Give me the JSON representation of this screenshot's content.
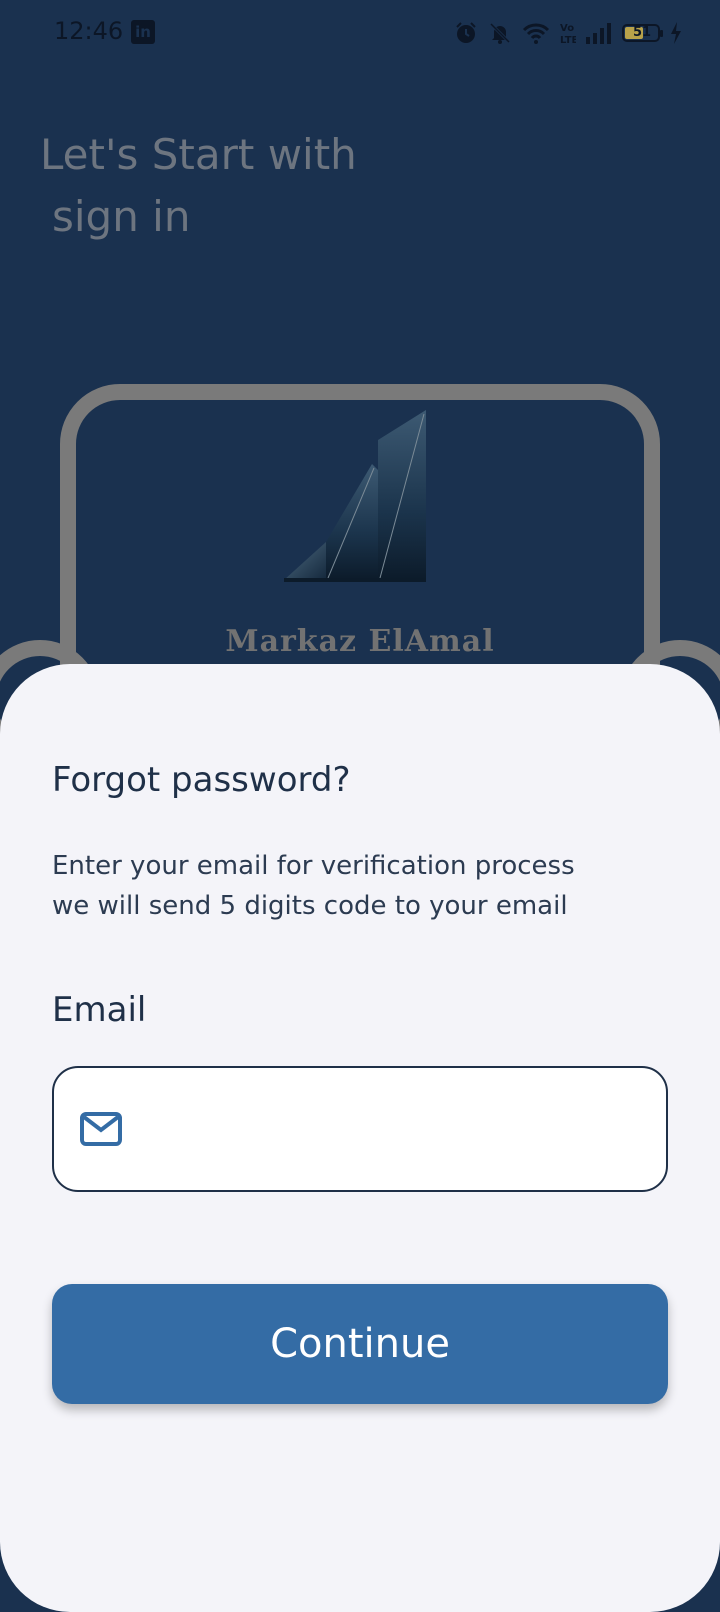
{
  "status_bar": {
    "time": "12:46",
    "app_icon": "linkedin-icon",
    "battery_level": "51",
    "icons": [
      "alarm-icon",
      "mute-icon",
      "wifi-icon",
      "volte-icon",
      "signal-icon",
      "battery-icon",
      "charging-icon"
    ]
  },
  "welcome": {
    "line1": "Let's Start with",
    "line2": "sign in"
  },
  "brand": {
    "name": "Markaz ElAmal"
  },
  "sheet": {
    "title": "Forgot password?",
    "description_line1": "Enter your email for verification process",
    "description_line2": "we will send 5 digits code to your email",
    "email_label": "Email",
    "email_value": "",
    "email_placeholder": "",
    "continue_label": "Continue"
  },
  "colors": {
    "background": "#1a314f",
    "sheet": "#f4f4f9",
    "primary": "#346ca5",
    "text_dark": "#1f3048",
    "muted": "#6d7580"
  }
}
